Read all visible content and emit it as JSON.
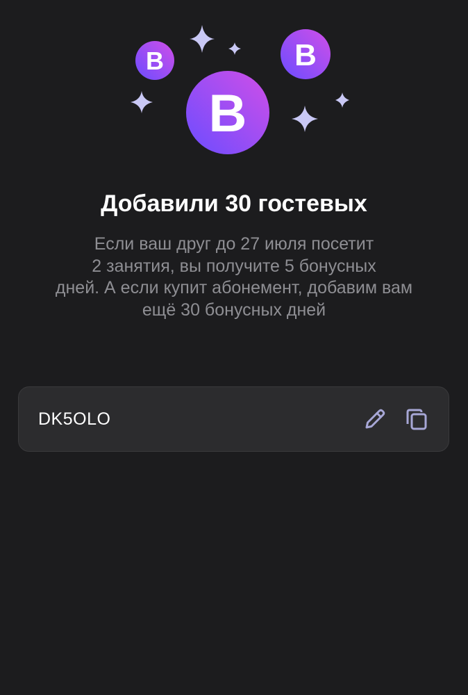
{
  "colors": {
    "background": "#1c1c1e",
    "card_background": "#2c2c2e",
    "title": "#ffffff",
    "description": "#8e8e93",
    "icon_tint": "#a7a7d6",
    "sparkle": "#c9c8f5",
    "badge_gradient_start": "#6b4dff",
    "badge_gradient_end": "#d04ee8"
  },
  "hero": {
    "badge_letter": "B",
    "icon": "sparkles-and-badges-illustration"
  },
  "title": "Добавили 30 гостевых",
  "description": {
    "lines": [
      "Если ваш друг до 27 июля посетит",
      "2 занятия, вы получите 5 бонусных",
      "дней. А если купит абонемент, добавим вам",
      "ещё 30 бонусных дней"
    ]
  },
  "promo": {
    "code": "DK5OLO",
    "edit_icon": "pencil-icon",
    "copy_icon": "copy-icon"
  }
}
